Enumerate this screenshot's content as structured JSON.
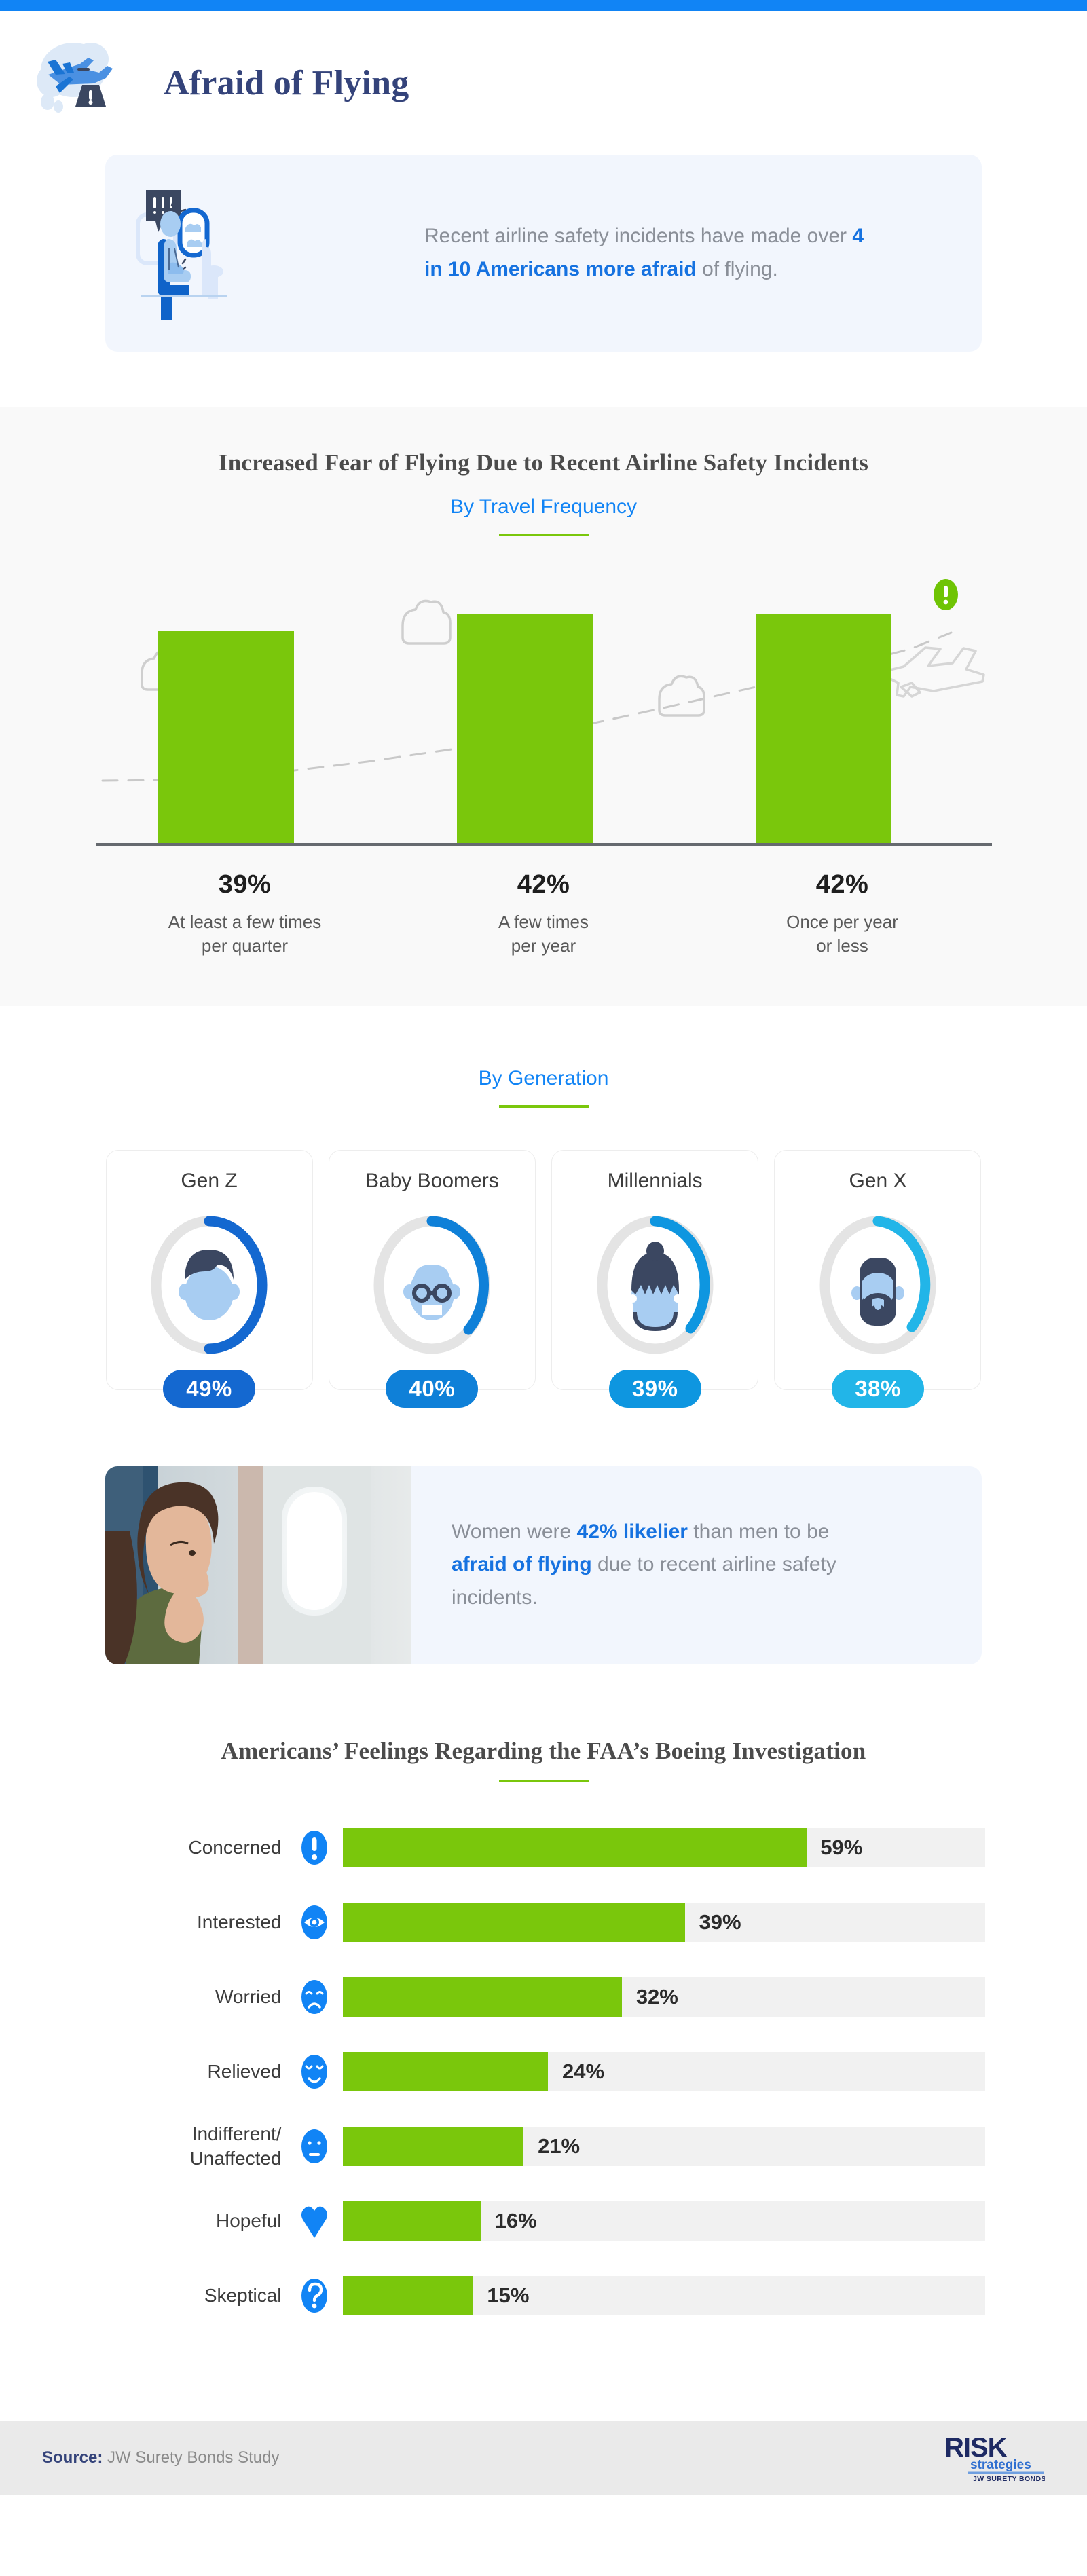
{
  "header": {
    "title": "Afraid of Flying",
    "logo_icon": "airplane-warning-icon"
  },
  "intro": {
    "art_icon": "anxious-passenger-illustration",
    "text_part1": "Recent airline safety incidents have made over ",
    "text_highlight": "4 in 10 Americans more afraid",
    "text_part2": " of flying."
  },
  "travel_frequency": {
    "title": "Increased Fear of Flying Due to Recent Airline Safety Incidents",
    "subtitle": "By Travel Frequency",
    "airplane_icon": "airplane-takeoff-icon",
    "alert_icon": "alert-exclamation-icon",
    "cloud_icon": "cloud-outline-icon"
  },
  "generation": {
    "subtitle": "By Generation",
    "cards": [
      {
        "name": "Gen Z",
        "value": "49%",
        "pct": 49,
        "color": "#1468d0",
        "avatar_icon": "gen-z-avatar-icon"
      },
      {
        "name": "Baby Boomers",
        "value": "40%",
        "pct": 40,
        "color": "#0f80d8",
        "avatar_icon": "baby-boomer-avatar-icon"
      },
      {
        "name": "Millennials",
        "value": "39%",
        "pct": 39,
        "color": "#0e96e0",
        "avatar_icon": "millennial-avatar-icon"
      },
      {
        "name": "Gen X",
        "value": "38%",
        "pct": 38,
        "color": "#22b5e8",
        "avatar_icon": "gen-x-avatar-icon"
      }
    ]
  },
  "women_callout": {
    "photo_icon": "woman-on-plane-photo",
    "text_part1": "Women were ",
    "text_highlight1": "42% likelier",
    "text_part2": " than men to be ",
    "text_highlight2": "afraid of flying",
    "text_part3": " due to recent airline safety incidents."
  },
  "faa": {
    "title": "Americans’ Feelings Regarding the FAA’s Boeing Investigation"
  },
  "footer": {
    "source_label": "Source:",
    "source_text": " JW Surety Bonds Study",
    "logo_main": "RISK",
    "logo_sub": "strategies",
    "logo_tag": "JW SURETY BONDS"
  },
  "chart_data": [
    {
      "type": "bar",
      "title": "Increased Fear of Flying Due to Recent Airline Safety Incidents",
      "subtitle": "By Travel Frequency",
      "orientation": "vertical",
      "categories": [
        "At least a few times per quarter",
        "A few times per year",
        "Once per year or less"
      ],
      "category_lines": [
        [
          "At least a few times",
          "per quarter"
        ],
        [
          "A few times",
          "per year"
        ],
        [
          "Once per year",
          "or less"
        ]
      ],
      "values": [
        39,
        42,
        42
      ],
      "value_labels": [
        "39%",
        "42%",
        "42%"
      ],
      "bar_color": "#7ac70c",
      "ylim": [
        0,
        48
      ],
      "grid": false,
      "legend": "none",
      "xlabel": "",
      "ylabel": ""
    },
    {
      "type": "bar",
      "title": "By Generation",
      "orientation": "donut",
      "categories": [
        "Gen Z",
        "Baby Boomers",
        "Millennials",
        "Gen X"
      ],
      "values": [
        49,
        40,
        39,
        38
      ],
      "value_labels": [
        "49%",
        "40%",
        "39%",
        "38%"
      ],
      "colors": [
        "#1468d0",
        "#0f80d8",
        "#0e96e0",
        "#22b5e8"
      ],
      "track_color": "#e2e2e2",
      "legend": "none"
    },
    {
      "type": "bar",
      "title": "Americans’ Feelings Regarding the FAA’s Boeing Investigation",
      "orientation": "horizontal",
      "categories": [
        "Concerned",
        "Interested",
        "Worried",
        "Relieved",
        "Indifferent/ Unaffected",
        "Hopeful",
        "Skeptical"
      ],
      "category_lines": [
        [
          "Concerned"
        ],
        [
          "Interested"
        ],
        [
          "Worried"
        ],
        [
          "Relieved"
        ],
        [
          "Indifferent/",
          "Unaffected"
        ],
        [
          "Hopeful"
        ],
        [
          "Skeptical"
        ]
      ],
      "values": [
        59,
        39,
        32,
        24,
        21,
        16,
        15
      ],
      "value_labels": [
        "59%",
        "39%",
        "32%",
        "24%",
        "21%",
        "16%",
        "15%"
      ],
      "icons": [
        "exclamation-icon",
        "eye-icon",
        "frowning-face-icon",
        "relieved-face-icon",
        "neutral-face-icon",
        "heart-icon",
        "question-mark-icon"
      ],
      "bar_color": "#7ac70c",
      "track_color": "#f1f1f1",
      "xlim": [
        0,
        82
      ],
      "grid": false,
      "legend": "none",
      "xlabel": "",
      "ylabel": ""
    }
  ]
}
